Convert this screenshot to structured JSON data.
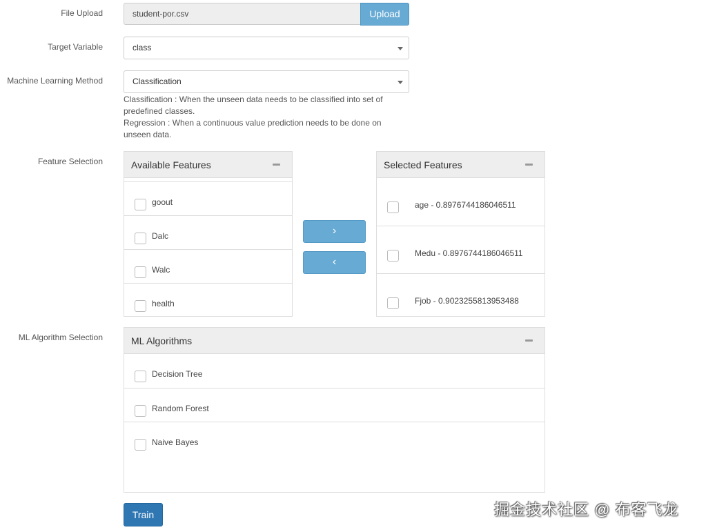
{
  "form": {
    "file_upload": {
      "label": "File Upload",
      "filename": "student-por.csv",
      "button": "Upload"
    },
    "target_variable": {
      "label": "Target Variable",
      "value": "class"
    },
    "ml_method": {
      "label": "Machine Learning Method",
      "value": "Classification",
      "help_classification": "Classification : When the unseen data needs to be classified into set of predefined classes.",
      "help_regression": "Regression : When a continuous value prediction needs to be done on unseen data."
    },
    "feature_selection": {
      "label": "Feature Selection",
      "available": {
        "title": "Available Features",
        "items": [
          "goout",
          "Dalc",
          "Walc",
          "health"
        ]
      },
      "selected": {
        "title": "Selected Features",
        "items": [
          "age - 0.8976744186046511",
          "Medu - 0.8976744186046511",
          "Fjob - 0.9023255813953488"
        ]
      },
      "move_right": "›",
      "move_left": "‹"
    },
    "ml_algorithm": {
      "label": "ML Algorithm Selection",
      "title": "ML Algorithms",
      "items": [
        "Decision Tree",
        "Random Forest",
        "Naive Bayes"
      ]
    },
    "train_button": "Train"
  },
  "watermark": "掘金技术社区 @ 布客飞龙",
  "icons": {
    "collapse": "minus-icon",
    "dropdown": "caret-down-icon"
  },
  "colors": {
    "primary": "#2e77b3",
    "light_primary": "#67aad4",
    "panel_header": "#eeeeee"
  }
}
